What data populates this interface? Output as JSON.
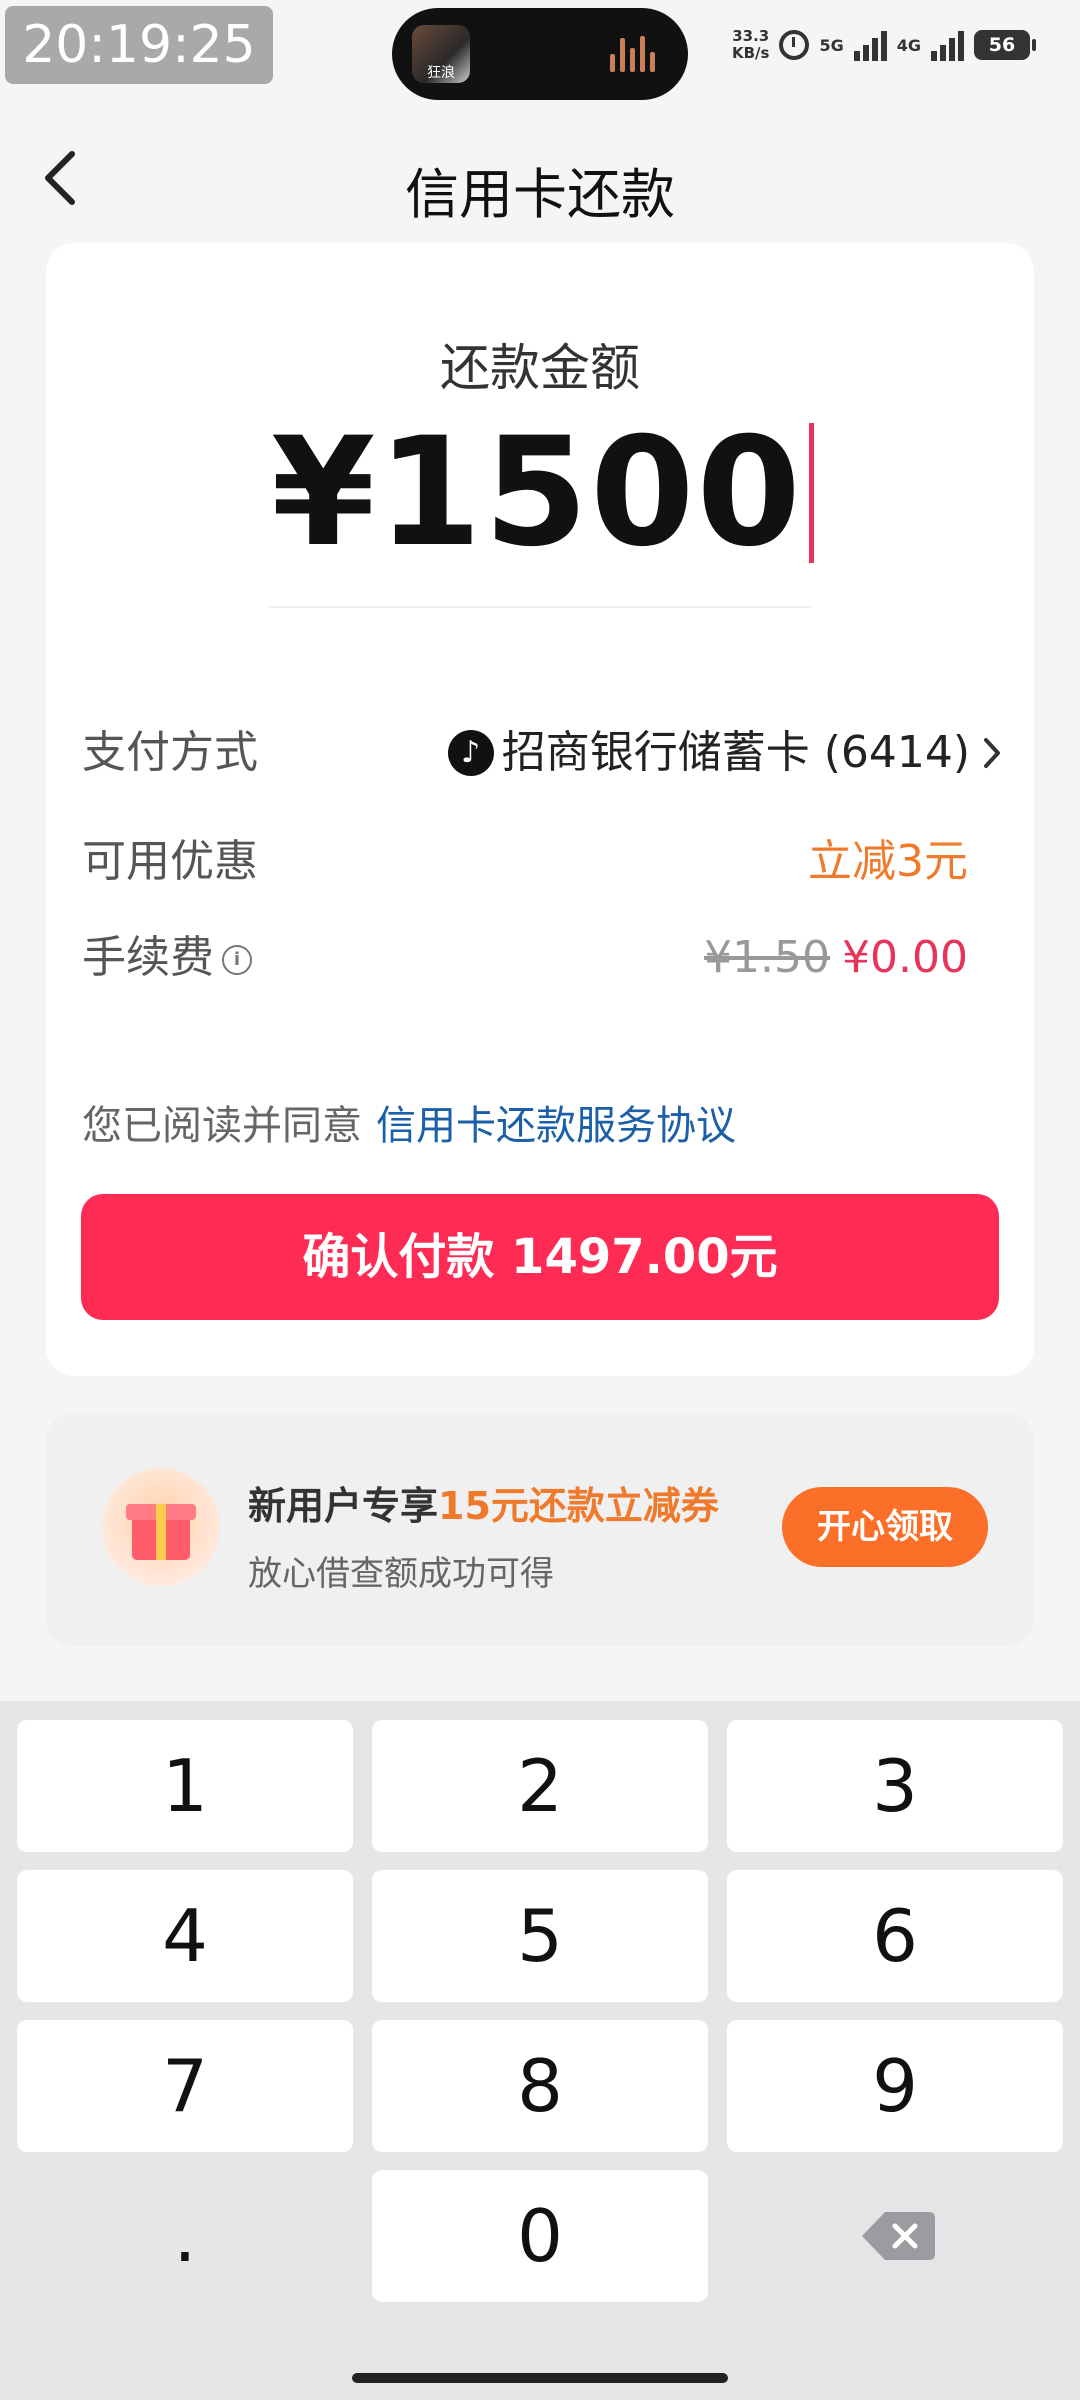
{
  "status_bar": {
    "time": "20:19:25",
    "island_label": "狂浪",
    "net_speed_value": "33.3",
    "net_speed_unit": "KB/s",
    "signal1_label": "5G",
    "signal2_label": "4G",
    "battery": "56"
  },
  "header": {
    "back_label": "‹",
    "title": "信用卡还款"
  },
  "amount": {
    "label": "还款金额",
    "value": "¥1500"
  },
  "rows": {
    "payment_label": "支付方式",
    "payment_value": "招商银行储蓄卡 (6414)",
    "discount_label": "可用优惠",
    "discount_value": "立减3元",
    "fee_label": "手续费",
    "fee_old": "¥1.50",
    "fee_new": "¥0.00"
  },
  "agreement": {
    "text": "您已阅读并同意",
    "link": "信用卡还款服务协议"
  },
  "pay_button": "确认付款 1497.00元",
  "promo": {
    "title_prefix": "新用户专享",
    "title_highlight": "15元还款立减券",
    "subtitle": "放心借查额成功可得",
    "button": "开心领取"
  },
  "keypad": [
    "1",
    "2",
    "3",
    "4",
    "5",
    "6",
    "7",
    "8",
    "9",
    ".",
    "0"
  ],
  "colors": {
    "accent": "#fe2c55",
    "discount": "#f07a2c",
    "link": "#1b5fa8"
  }
}
